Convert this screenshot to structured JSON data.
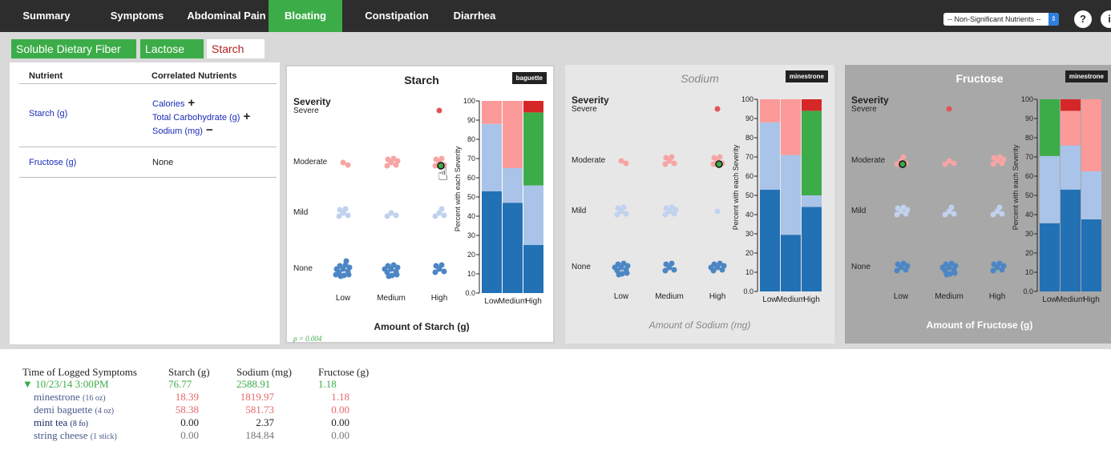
{
  "nav": {
    "tabs": [
      {
        "label": "Summary",
        "active": false
      },
      {
        "label": "Symptoms",
        "active": false
      },
      {
        "label": "Abdominal Pain",
        "active": false
      },
      {
        "label": "Bloating",
        "active": true
      },
      {
        "label": "Constipation",
        "active": false
      },
      {
        "label": "Diarrhea",
        "active": false
      }
    ],
    "nutrient_select": "-- Non-Significant Nutrients --",
    "help_label": "?",
    "info_label": "i"
  },
  "nutrient_tabs": [
    {
      "label": "Soluble Dietary Fiber (g)",
      "selected": false
    },
    {
      "label": "Lactose (g)",
      "selected": false
    },
    {
      "label": "Starch (g)",
      "selected": true
    }
  ],
  "correlations": {
    "headers": {
      "nutrient": "Nutrient",
      "correlated": "Correlated Nutrients"
    },
    "rows": [
      {
        "nutrient": "Starch (g)",
        "correlated": [
          {
            "label": "Calories",
            "sign": "+"
          },
          {
            "label": "Total Carbohydrate (g)",
            "sign": "+"
          },
          {
            "label": "Sodium (mg)",
            "sign": "−"
          }
        ]
      },
      {
        "nutrient": "Fructose (g)",
        "none_label": "None"
      }
    ]
  },
  "panels": [
    {
      "title": "Starch",
      "badge": "baguette",
      "theme": "white",
      "axis_title": "Amount of Starch (g)",
      "p_value": "p = 0.004",
      "severity_label": "Severity",
      "levels": [
        "Severe",
        "Moderate",
        "Mild",
        "None"
      ],
      "amount_labels": [
        "Low",
        "Medium",
        "High"
      ],
      "dot_counts": {
        "Severe": [
          0,
          0,
          1
        ],
        "Moderate": [
          2,
          6,
          5
        ],
        "Mild": [
          5,
          3,
          4
        ],
        "None": [
          12,
          10,
          5
        ]
      },
      "highlight": {
        "level": "Moderate",
        "column": "High",
        "has_cursor": true
      },
      "chart_data": {
        "type": "bar",
        "categories": [
          "Low",
          "Medium",
          "High"
        ],
        "series": [
          {
            "name": "None",
            "color": "#2271b5",
            "values": [
              53,
              47,
              25
            ]
          },
          {
            "name": "Mild",
            "color": "#a9c4e8",
            "values": [
              35,
              18,
              31
            ]
          },
          {
            "name": "Moderate",
            "color": "#fb9a99",
            "values": [
              12,
              35,
              0
            ]
          },
          {
            "name": "Moderate (significant)",
            "color": "#3cac48",
            "values": [
              0,
              0,
              38
            ]
          },
          {
            "name": "Severe",
            "color": "#d62728",
            "values": [
              0,
              0,
              6
            ]
          }
        ],
        "ylabel": "Percent with each Severity",
        "yticks": [
          "0.0",
          "10",
          "20",
          "30",
          "40",
          "50",
          "60",
          "70",
          "80",
          "90",
          "100"
        ],
        "ylim": [
          0,
          100
        ]
      }
    },
    {
      "title": "Sodium",
      "badge": "minestrone",
      "theme": "light",
      "axis_title": "Amount of Sodium (mg)",
      "p_value": "",
      "severity_label": "Severity",
      "levels": [
        "Severe",
        "Moderate",
        "Mild",
        "None"
      ],
      "amount_labels": [
        "Low",
        "Medium",
        "High"
      ],
      "dot_counts": {
        "Severe": [
          0,
          0,
          1
        ],
        "Moderate": [
          2,
          5,
          5
        ],
        "Mild": [
          5,
          6,
          1
        ],
        "None": [
          10,
          5,
          7
        ]
      },
      "highlight": {
        "level": "Moderate",
        "column": "High",
        "has_cursor": false
      },
      "chart_data": {
        "type": "bar",
        "categories": [
          "Low",
          "Medium",
          "High"
        ],
        "series": [
          {
            "name": "None",
            "color": "#2271b5",
            "values": [
              53,
              29.5,
              44
            ]
          },
          {
            "name": "Mild",
            "color": "#a9c4e8",
            "values": [
              35,
              41.5,
              6
            ]
          },
          {
            "name": "Moderate",
            "color": "#fb9a99",
            "values": [
              12,
              29,
              0
            ]
          },
          {
            "name": "Moderate (significant)",
            "color": "#3cac48",
            "values": [
              0,
              0,
              44
            ]
          },
          {
            "name": "Severe",
            "color": "#d62728",
            "values": [
              0,
              0,
              6
            ]
          }
        ],
        "ylabel": "Percent with each Severity",
        "yticks": [
          "0.0",
          "10",
          "20",
          "30",
          "40",
          "50",
          "60",
          "70",
          "80",
          "90",
          "100"
        ],
        "ylim": [
          0,
          100
        ]
      }
    },
    {
      "title": "Fructose",
      "badge": "minestrone",
      "theme": "dark",
      "axis_title": "Amount of Fructose (g)",
      "p_value": "",
      "severity_label": "Severity",
      "levels": [
        "Severe",
        "Moderate",
        "Mild",
        "None"
      ],
      "amount_labels": [
        "Low",
        "Medium",
        "High"
      ],
      "dot_counts": {
        "Severe": [
          0,
          1,
          0
        ],
        "Moderate": [
          4,
          3,
          6
        ],
        "Mild": [
          6,
          4,
          4
        ],
        "None": [
          6,
          10,
          6
        ]
      },
      "highlight": {
        "level": "Moderate",
        "column": "Low",
        "has_cursor": false
      },
      "chart_data": {
        "type": "bar",
        "categories": [
          "Low",
          "Medium",
          "High"
        ],
        "series": [
          {
            "name": "None",
            "color": "#2271b5",
            "values": [
              35.5,
              53,
              37.5
            ]
          },
          {
            "name": "Mild",
            "color": "#a9c4e8",
            "values": [
              35,
              23,
              25
            ]
          },
          {
            "name": "Moderate",
            "color": "#fb9a99",
            "values": [
              0,
              18,
              37.5
            ]
          },
          {
            "name": "Moderate (significant)",
            "color": "#3cac48",
            "values": [
              29.5,
              0,
              0
            ]
          },
          {
            "name": "Severe",
            "color": "#d62728",
            "values": [
              0,
              6,
              0
            ]
          }
        ],
        "ylabel": "Percent with each Severity",
        "yticks": [
          "0.0",
          "10",
          "20",
          "30",
          "40",
          "50",
          "60",
          "70",
          "80",
          "90",
          "100"
        ],
        "ylim": [
          0,
          100
        ]
      }
    }
  ],
  "log": {
    "headers": [
      "Time of Logged Symptoms",
      "Starch (g)",
      "Sodium (mg)",
      "Fructose (g)"
    ],
    "entry": {
      "time": "10/23/14 3:00PM",
      "totals": [
        "76.77",
        "2588.91",
        "1.18"
      ]
    },
    "foods": [
      {
        "name": "minestrone",
        "amount": "(16 oz)",
        "values": [
          "18.39",
          "1819.97",
          "1.18"
        ],
        "color": "#e8676a"
      },
      {
        "name": "demi baguette",
        "amount": "(4 oz)",
        "values": [
          "58.38",
          "581.73",
          "0.00"
        ],
        "color": "#e8676a"
      },
      {
        "name": "mint tea",
        "amount": "(8 fo)",
        "values": [
          "0.00",
          "2.37",
          "0.00"
        ],
        "color": "#222222"
      },
      {
        "name": "string cheese",
        "amount": "(1 stick)",
        "values": [
          "0.00",
          "184.84",
          "0.00"
        ],
        "color": "#777777"
      }
    ]
  }
}
